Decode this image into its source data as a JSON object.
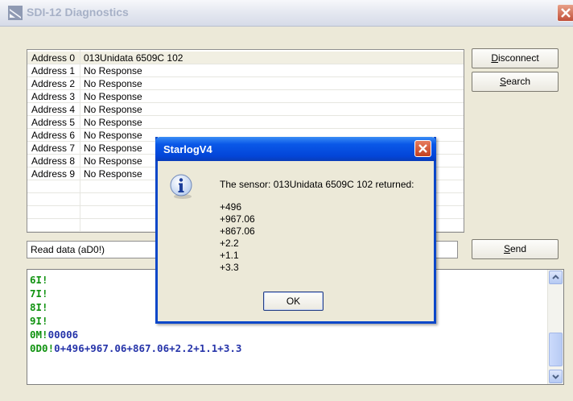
{
  "window": {
    "title": "SDI-12 Diagnostics"
  },
  "addresses": [
    {
      "address": "Address 0",
      "status": "013Unidata 6509C 102"
    },
    {
      "address": "Address 1",
      "status": "No Response"
    },
    {
      "address": "Address 2",
      "status": "No Response"
    },
    {
      "address": "Address 3",
      "status": "No Response"
    },
    {
      "address": "Address 4",
      "status": "No Response"
    },
    {
      "address": "Address 5",
      "status": "No Response"
    },
    {
      "address": "Address 6",
      "status": "No Response"
    },
    {
      "address": "Address 7",
      "status": "No Response"
    },
    {
      "address": "Address 8",
      "status": "No Response"
    },
    {
      "address": "Address 9",
      "status": "No Response"
    }
  ],
  "buttons": {
    "disconnect": {
      "accel": "D",
      "rest": "isconnect"
    },
    "search": {
      "accel": "S",
      "rest": "earch"
    },
    "send": {
      "accel": "S",
      "rest": "end"
    }
  },
  "command": {
    "value": "Read data (aD0!)"
  },
  "log": [
    {
      "cmd": "6I!",
      "resp": ""
    },
    {
      "cmd": "7I!",
      "resp": ""
    },
    {
      "cmd": "8I!",
      "resp": ""
    },
    {
      "cmd": "9I!",
      "resp": ""
    },
    {
      "cmd": "0M!",
      "resp": "00006"
    },
    {
      "cmd": "0D0!",
      "resp": "0+496+967.06+867.06+2.2+1.1+3.3"
    }
  ],
  "dialog": {
    "title": "StarlogV4",
    "message": "The sensor: 013Unidata 6509C 102 returned:",
    "values": [
      "+496",
      "+967.06",
      "+867.06",
      "+2.2",
      "+1.1",
      "+3.3"
    ],
    "ok_label": "OK"
  },
  "colors": {
    "command_text": "#119311",
    "response_text": "#2634a9",
    "dialog_title": "#0a58e8"
  }
}
